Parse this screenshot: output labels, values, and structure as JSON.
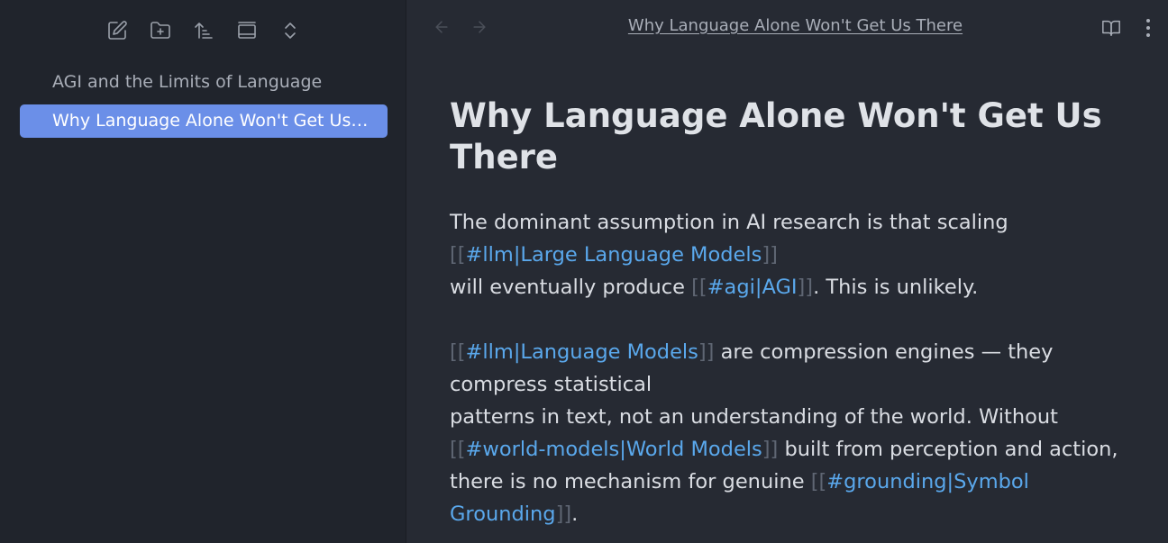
{
  "sidebar": {
    "toolbar": {
      "new_note": "new-note-icon",
      "new_folder": "new-folder-icon",
      "sort": "sort-icon",
      "auto_reveal": "reveal-icon",
      "collapse": "collapse-expand-icon"
    },
    "files": [
      {
        "label": "AGI and the Limits of Language",
        "active": false
      },
      {
        "label": "Why Language Alone Won't Get Us T...",
        "active": true
      }
    ]
  },
  "header": {
    "back": "arrow-left-icon",
    "forward": "arrow-right-icon",
    "title": "Why Language Alone Won't Get Us There",
    "reading_view": "book-open-icon",
    "more": "more-options-icon"
  },
  "document": {
    "title_line1": "Why Language Alone Won't Get Us",
    "title_line2": "There",
    "p1": {
      "l1": "The dominant assumption in AI research is that scaling",
      "l2_open": "[[",
      "l2_link": "#llm|Large Language Models",
      "l2_close": "]]",
      "l3_text": "will eventually produce ",
      "l3_open": "[[",
      "l3_link": "#agi|AGI",
      "l3_close": "]]",
      "l3_end": ". This is unlikely."
    },
    "p2": {
      "l1_open": "[[",
      "l1_link": "#llm|Language Models",
      "l1_close": "]]",
      "l1_text": " are compression engines — they",
      "l2": "compress statistical",
      "l3": "patterns in text, not an understanding of the world. Without",
      "l4_open": "[[",
      "l4_link": "#world-models|World Models",
      "l4_close": "]]",
      "l4_text": " built from perception and action,",
      "l5_text": "there is no mechanism for genuine ",
      "l5_open": "[[",
      "l5_link": "#grounding|Symbol",
      "l6_link": "Grounding",
      "l6_close": "]]",
      "l6_end": "."
    }
  },
  "colors": {
    "background": "#262a33",
    "sidebar": "#20242c",
    "accent": "#6b8fe8",
    "link": "#5aa8ec"
  }
}
